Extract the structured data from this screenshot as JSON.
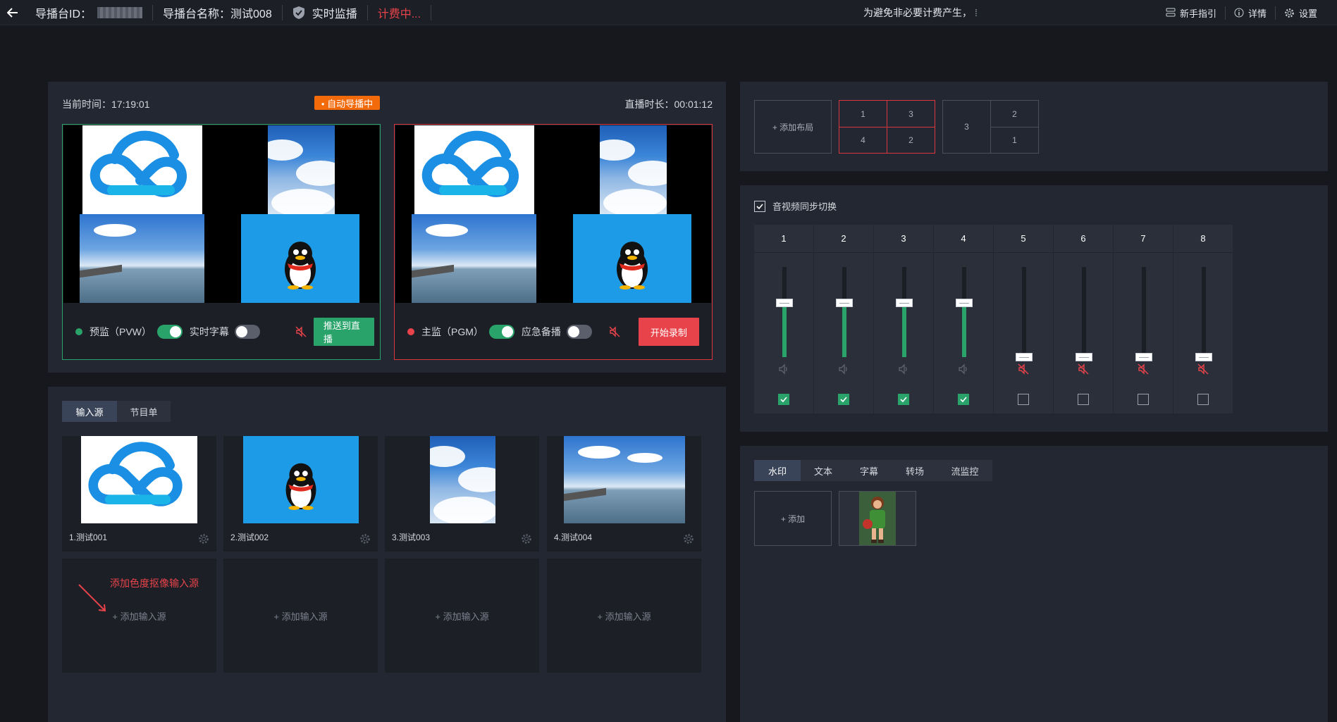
{
  "topbar": {
    "director_id_label": "导播台ID：",
    "director_name": "导播台名称：测试008",
    "live_monitor": "实时监播",
    "billing": "计费中...",
    "warning": "为避免非必要计费产生，",
    "guide": "新手指引",
    "details": "详情",
    "settings": "设置"
  },
  "monitor": {
    "current_time_label": "当前时间：17:19:01",
    "auto_badge": "• 自动导播中",
    "duration_label": "直播时长：00:01:12",
    "preview": {
      "label": "预监（PVW）",
      "subtitle_label": "实时字幕",
      "push_button": "推送到直播",
      "auto_on": true,
      "subtitle_on": false
    },
    "program": {
      "label": "主监（PGM）",
      "backup_label": "应急备播",
      "record_button": "开始录制",
      "main_on": true,
      "backup_on": false
    }
  },
  "sources": {
    "tabs": [
      "输入源",
      "节目单"
    ],
    "active_tab": 0,
    "items": [
      {
        "name": "1.测试001",
        "thumb": "cloud-logo"
      },
      {
        "name": "2.测试002",
        "thumb": "penguin"
      },
      {
        "name": "3.测试003",
        "thumb": "sky"
      },
      {
        "name": "4.测试004",
        "thumb": "sea-pier"
      }
    ],
    "add_label": "+ 添加输入源",
    "hint": "添加色度抠像输入源"
  },
  "layouts": {
    "add_label": "+ 添加布局",
    "layout_a": [
      "1",
      "3",
      "4",
      "2"
    ],
    "layout_b": [
      "3",
      "2",
      "1"
    ]
  },
  "audio": {
    "sync_label": "音视频同步切换",
    "sync_checked": true,
    "channels": [
      {
        "num": "1",
        "level": 0.6,
        "muted": false,
        "checked": true
      },
      {
        "num": "2",
        "level": 0.6,
        "muted": false,
        "checked": true
      },
      {
        "num": "3",
        "level": 0.6,
        "muted": false,
        "checked": true
      },
      {
        "num": "4",
        "level": 0.6,
        "muted": false,
        "checked": true
      },
      {
        "num": "5",
        "level": 0.0,
        "muted": true,
        "checked": false
      },
      {
        "num": "6",
        "level": 0.0,
        "muted": true,
        "checked": false
      },
      {
        "num": "7",
        "level": 0.0,
        "muted": true,
        "checked": false
      },
      {
        "num": "8",
        "level": 0.0,
        "muted": true,
        "checked": false
      }
    ]
  },
  "overlay": {
    "tabs": [
      "水印",
      "文本",
      "字幕",
      "转场",
      "流监控"
    ],
    "active_tab": 0,
    "add_label": "+ 添加"
  },
  "colors": {
    "accent_green": "#29a36a",
    "accent_red": "#e8434a",
    "badge_orange": "#f36a0a"
  }
}
